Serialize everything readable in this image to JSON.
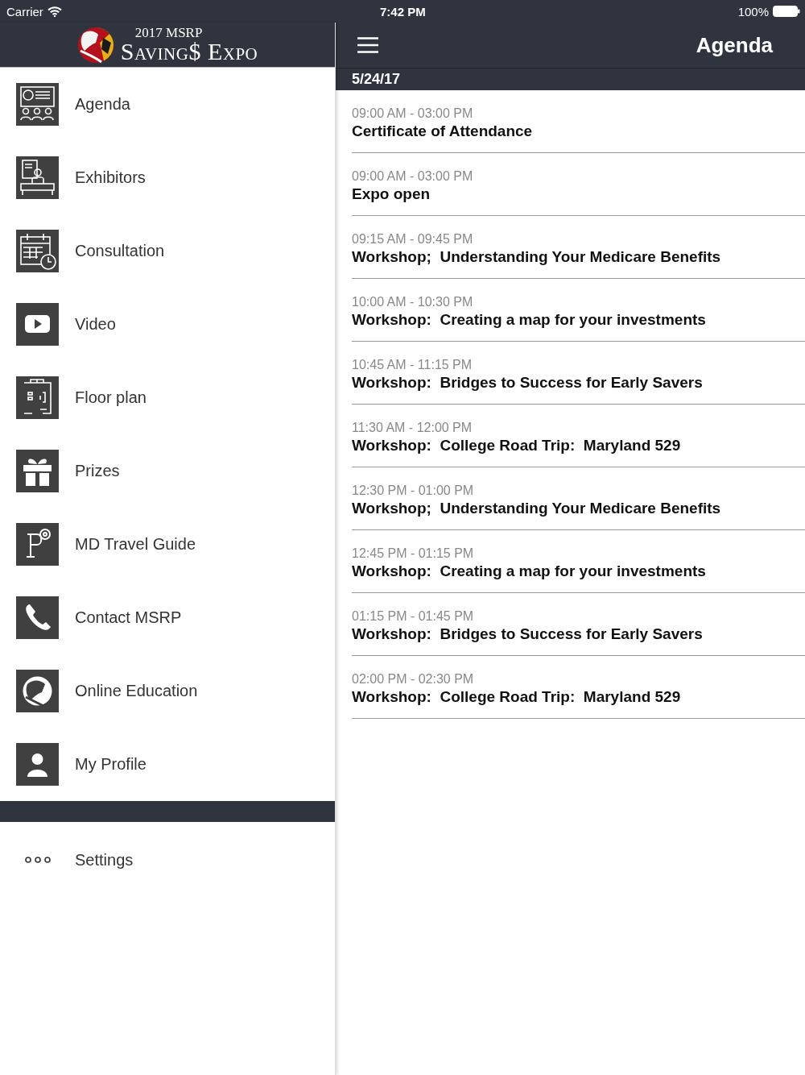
{
  "status_bar": {
    "carrier": "Carrier",
    "time": "7:42 PM",
    "battery": "100%"
  },
  "logo": {
    "year_line": "2017 MSRP",
    "name": "Saving$ Expo"
  },
  "menu": [
    {
      "label": "Agenda"
    },
    {
      "label": "Exhibitors"
    },
    {
      "label": "Consultation"
    },
    {
      "label": "Video"
    },
    {
      "label": "Floor plan"
    },
    {
      "label": "Prizes"
    },
    {
      "label": "MD Travel Guide"
    },
    {
      "label": "Contact MSRP"
    },
    {
      "label": "Online Education"
    },
    {
      "label": "My Profile"
    }
  ],
  "settings": {
    "label": "Settings"
  },
  "nav": {
    "title": "Agenda"
  },
  "date": "5/24/17",
  "agenda": [
    {
      "time": "09:00 AM - 03:00 PM",
      "title": "Certificate of Attendance"
    },
    {
      "time": "09:00 AM - 03:00 PM",
      "title": "Expo open"
    },
    {
      "time": "09:15 AM - 09:45 PM",
      "title": "Workshop;  Understanding Your Medicare Benefits"
    },
    {
      "time": "10:00 AM - 10:30 PM",
      "title": "Workshop:  Creating a map for your investments"
    },
    {
      "time": "10:45 AM - 11:15 PM",
      "title": "Workshop:  Bridges to Success for Early Savers"
    },
    {
      "time": "11:30 AM - 12:00 PM",
      "title": "Workshop:  College Road Trip:  Maryland 529"
    },
    {
      "time": "12:30 PM - 01:00 PM",
      "title": "Workshop;  Understanding Your Medicare Benefits"
    },
    {
      "time": "12:45 PM - 01:15 PM",
      "title": "Workshop:  Creating a map for your investments"
    },
    {
      "time": "01:15 PM - 01:45 PM",
      "title": "Workshop:  Bridges to Success for Early Savers"
    },
    {
      "time": "02:00 PM - 02:30 PM",
      "title": "Workshop:  College Road Trip:  Maryland 529"
    }
  ]
}
